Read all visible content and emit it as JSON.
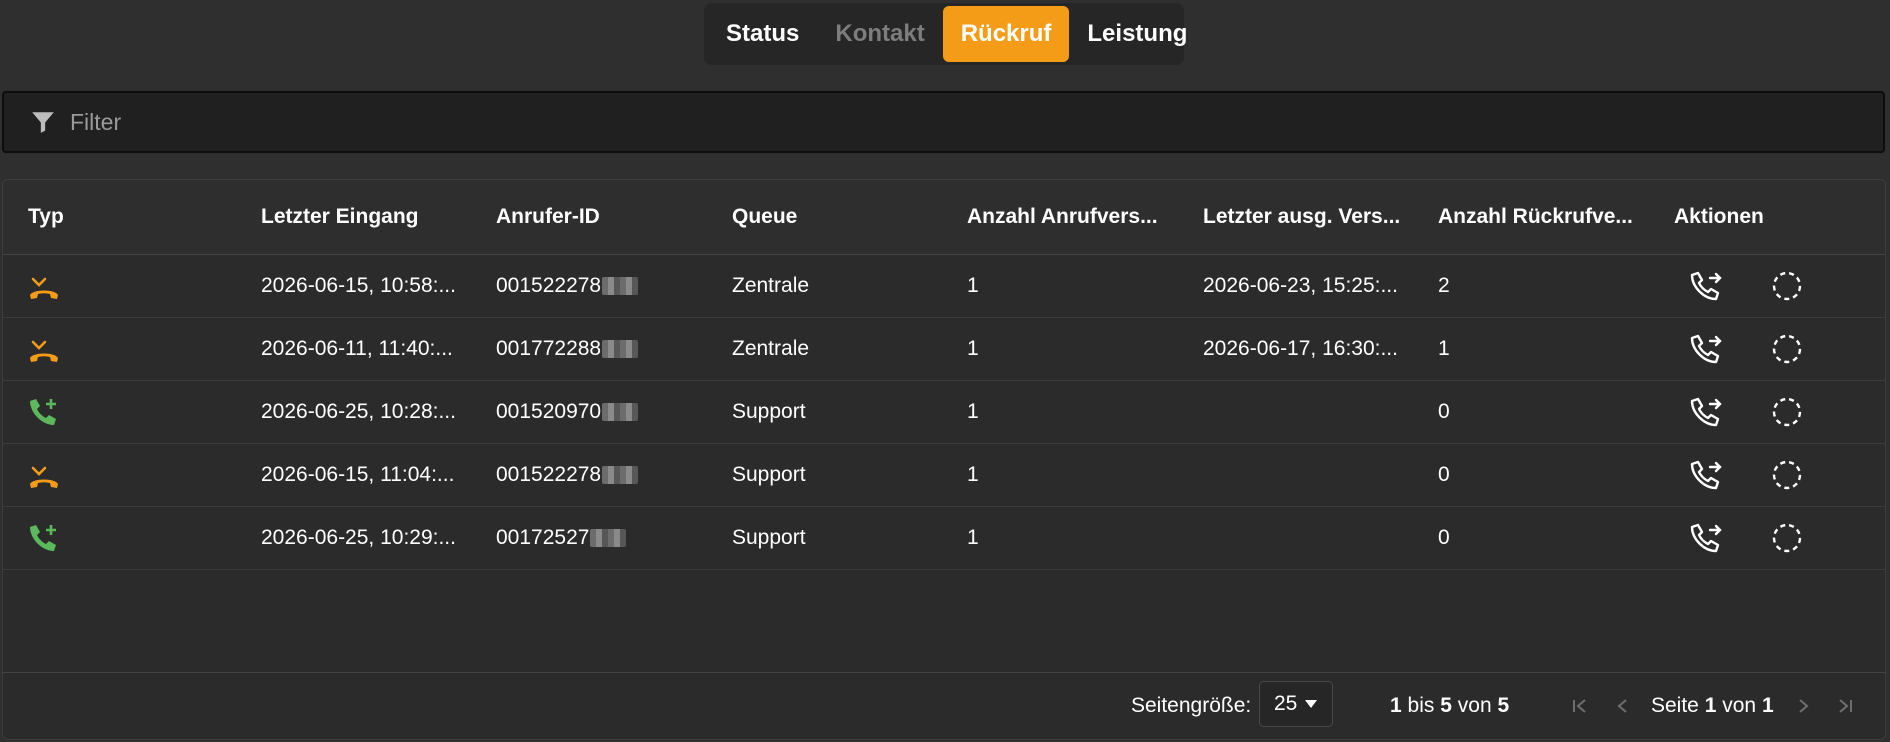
{
  "tabs": [
    {
      "label": "Status"
    },
    {
      "label": "Kontakt"
    },
    {
      "label": "Rückruf"
    },
    {
      "label": "Leistung"
    }
  ],
  "filter": {
    "placeholder": "Filter"
  },
  "columns": [
    "Typ",
    "Letzter Eingang",
    "Anrufer-ID",
    "Queue",
    "Anzahl Anrufvers...",
    "Letzter ausg. Vers...",
    "Anzahl Rückrufve...",
    "Aktionen"
  ],
  "rows": [
    {
      "type_icon": "missed-call-icon",
      "last_in": "2026-06-15, 10:58:...",
      "caller": "001522278",
      "queue": "Zentrale",
      "attempts": "1",
      "last_out": "2026-06-23, 15:25:...",
      "callbacks": "2"
    },
    {
      "type_icon": "missed-call-icon",
      "last_in": "2026-06-11, 11:40:...",
      "caller": "001772288",
      "queue": "Zentrale",
      "attempts": "1",
      "last_out": "2026-06-17, 16:30:...",
      "callbacks": "1"
    },
    {
      "type_icon": "phone-plus-icon",
      "last_in": "2026-06-25, 10:28:...",
      "caller": "001520970",
      "queue": "Support",
      "attempts": "1",
      "last_out": "",
      "callbacks": "0"
    },
    {
      "type_icon": "missed-call-icon",
      "last_in": "2026-06-15, 11:04:...",
      "caller": "001522278",
      "queue": "Support",
      "attempts": "1",
      "last_out": "",
      "callbacks": "0"
    },
    {
      "type_icon": "phone-plus-icon",
      "last_in": "2026-06-25, 10:29:...",
      "caller": "00172527",
      "queue": "Support",
      "attempts": "1",
      "last_out": "",
      "callbacks": "0"
    }
  ],
  "colors": {
    "accent": "#f49c17",
    "incoming": "#5cb85c"
  },
  "pagination": {
    "page_size_label": "Seitengröße:",
    "page_size": "25",
    "range_from": "1",
    "range_mid": "bis",
    "range_to": "5",
    "range_of": "von",
    "range_total": "5",
    "page_label": "Seite",
    "page_current": "1",
    "page_of": "von",
    "page_total": "1"
  }
}
